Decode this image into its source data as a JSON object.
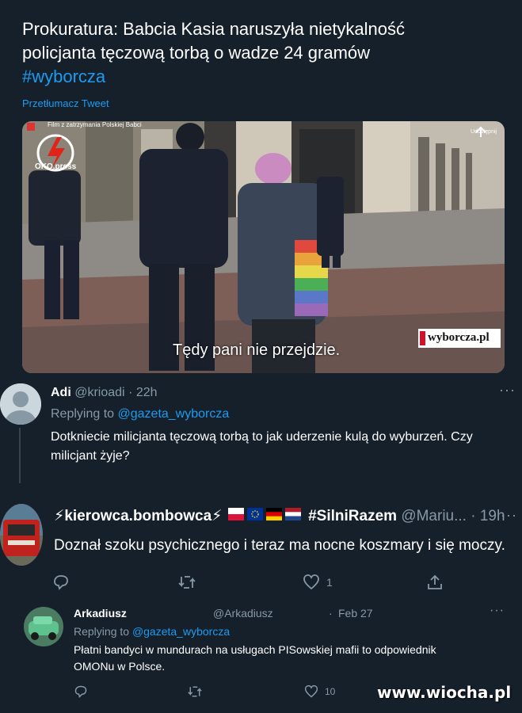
{
  "top_tweet": {
    "text_line1": "Prokuratura: Babcia Kasia naruszyła nietykalność",
    "text_line2": "policjanta tęczową torbą o wadze 24 gramów",
    "hashtag": "#wyborcza",
    "translate_label": "Przetłumacz Tweet",
    "media": {
      "overlay_title": "Film z zatrzymania Polskiej Babci",
      "oko_label": "OKO.press",
      "subtitle": "Tędy pani nie przejdzie.",
      "watermark": "wyborcza.pl",
      "share_label": "Udostępnij"
    }
  },
  "reply1": {
    "name": "Adi",
    "handle": "@krioadi",
    "time": "22h",
    "replying_prefix": "Replying to",
    "replying_to": "@gazeta_wyborcza",
    "text_line1": "Dotkniecie milicjanta tęczową torbą to jak uderzenie kulą do wyburzeń. Czy",
    "text_line2": "milicjant żyje?"
  },
  "reply2": {
    "name": "⚡kierowca.bombowca⚡",
    "name_tag": "#SilniRazem",
    "handle": "@Mariu...",
    "time": "19h",
    "text": "Doznał szoku psychicznego i teraz ma nocne koszmary i się moczy.",
    "like_count": "1"
  },
  "reply3": {
    "name": "Arkadiusz",
    "handle": "@Arkadiusz",
    "time": "Feb 27",
    "replying_prefix": "Replying to",
    "replying_to": "@gazeta_wyborcza",
    "text_line1": "Płatni bandyci w mundurach na usługach PISowskiej mafii to odpowiednik",
    "text_line2": "OMONu w Polsce.",
    "like_count": "10"
  },
  "site_watermark": "www.wiocha.pl",
  "colors": {
    "bg": "#15202b",
    "accent": "#1d9bf0",
    "muted": "#8899a6"
  },
  "icons": [
    "more-icon",
    "reply-icon",
    "retweet-icon",
    "like-icon",
    "share-icon",
    "oko-logo-icon",
    "share-icon"
  ]
}
